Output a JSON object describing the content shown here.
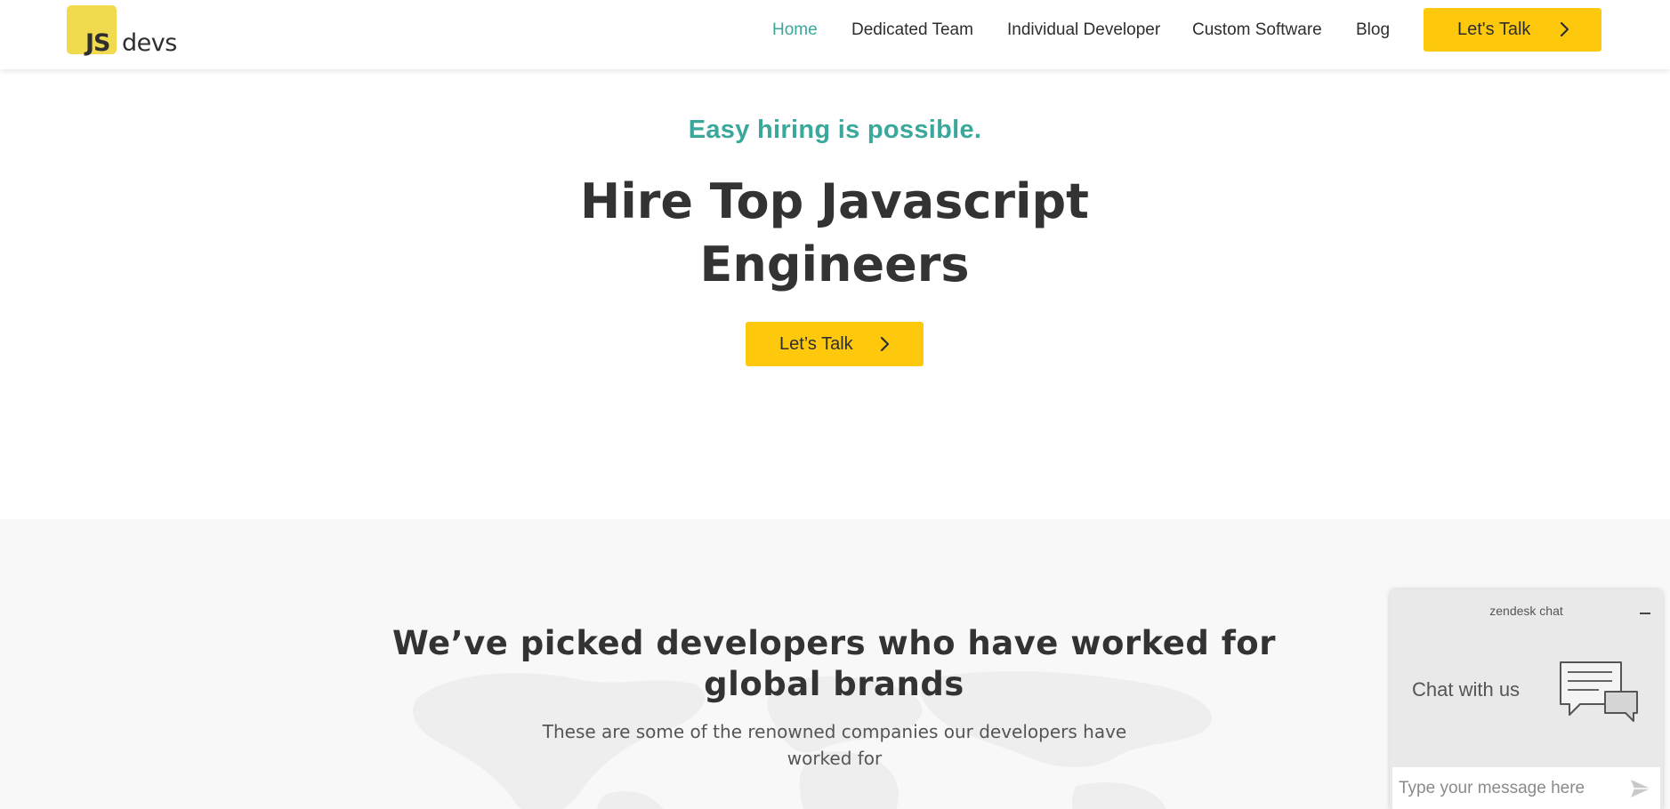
{
  "header": {
    "logo": {
      "mark": "JS",
      "text": "devs"
    },
    "nav": [
      {
        "label": "Home",
        "active": true
      },
      {
        "label": "Dedicated Team"
      },
      {
        "label": "Individual Developer"
      },
      {
        "label": "Custom Software"
      },
      {
        "label": "Blog"
      }
    ],
    "cta_label": "Let's Talk"
  },
  "hero": {
    "kicker": "Easy hiring is possible.",
    "title": "Hire Top Javascript Engineers",
    "cta_label": "Let’s Talk"
  },
  "brands": {
    "title": "We’ve picked developers who have worked for global brands",
    "subtitle": "These are some of the renowned companies our developers have worked for"
  },
  "chat": {
    "brand": "zendesk chat",
    "title": "Chat with us",
    "input_placeholder": "Type your message here"
  },
  "colors": {
    "accent_teal": "#39a89b",
    "cta_yellow": "#fec90d",
    "logo_yellow": "#f0db4f",
    "text_dark": "#333333"
  },
  "icons": {
    "nav_cta": "chevron-right-icon",
    "hero_cta": "chevron-right-icon",
    "chat_minimize": "minimize-icon",
    "chat_illustration": "chat-bubbles-icon",
    "chat_send": "send-icon"
  }
}
